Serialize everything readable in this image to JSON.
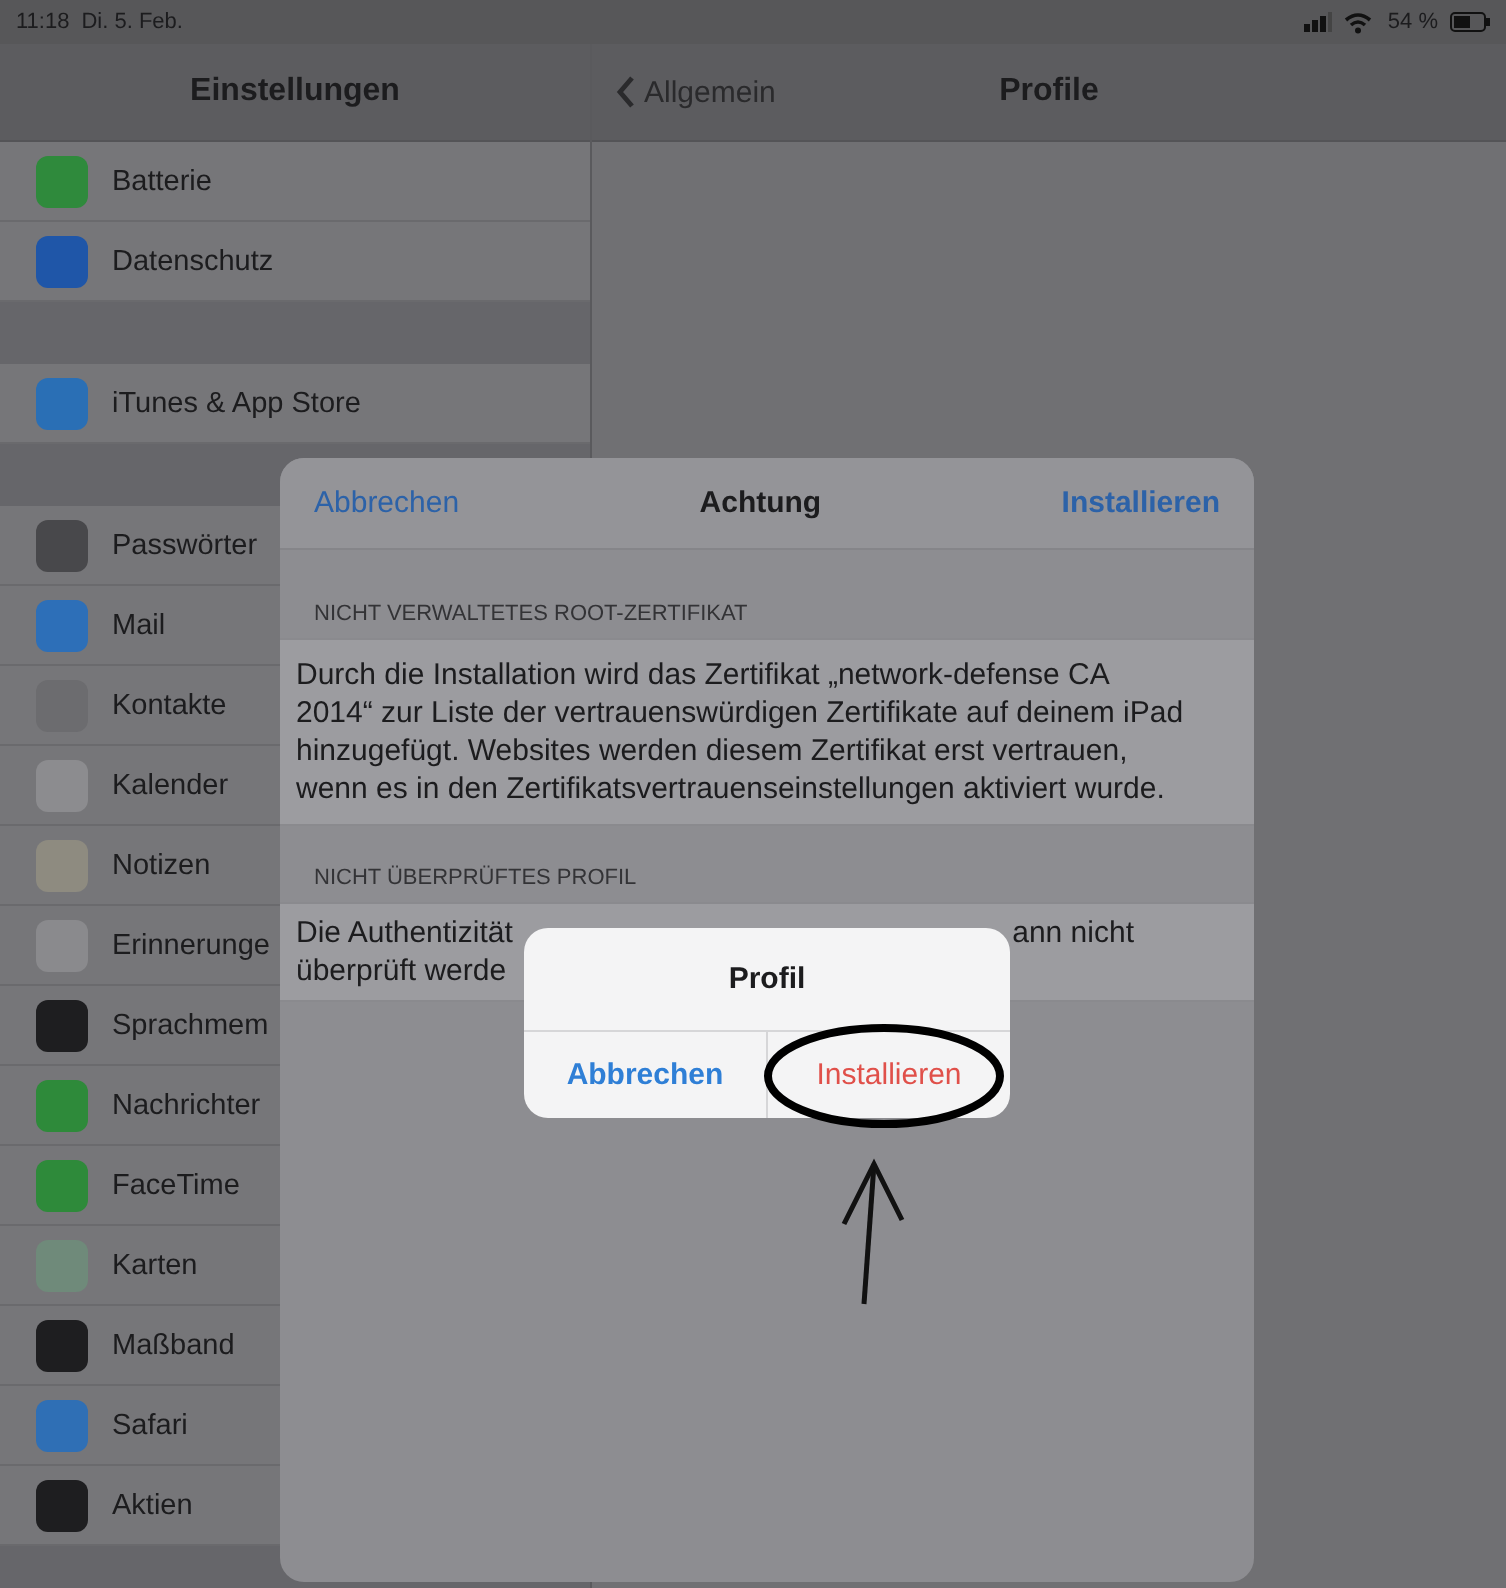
{
  "status_bar": {
    "time": "11:18",
    "date": "Di. 5. Feb.",
    "battery": "54 %"
  },
  "sidebar": {
    "title": "Einstellungen",
    "groups": [
      {
        "items": [
          {
            "label": "Batterie",
            "color": "#2f8a3c"
          },
          {
            "label": "Datenschutz",
            "color": "#1f56a8"
          }
        ]
      },
      {
        "items": [
          {
            "label": "iTunes & App Store",
            "color": "#2a6fb5"
          }
        ]
      },
      {
        "items": [
          {
            "label": "Passwörter",
            "color": "#48484b"
          },
          {
            "label": "Mail",
            "color": "#2d6fb8"
          },
          {
            "label": "Kontakte",
            "color": "#6c6c6f"
          },
          {
            "label": "Kalender",
            "color": "#8c8c8f"
          },
          {
            "label": "Notizen",
            "color": "#8e8b80"
          },
          {
            "label": "Erinnerunge",
            "color": "#8a8a8d"
          },
          {
            "label": "Sprachmem",
            "color": "#1e1e20"
          },
          {
            "label": "Nachrichter",
            "color": "#2e8a3a"
          },
          {
            "label": "FaceTime",
            "color": "#2e8a3a"
          },
          {
            "label": "Karten",
            "color": "#6f8a7a"
          },
          {
            "label": "Maßband",
            "color": "#1e1e20"
          },
          {
            "label": "Safari",
            "color": "#2f6fb5"
          },
          {
            "label": "Aktien",
            "color": "#1e1e20"
          }
        ]
      }
    ]
  },
  "detail": {
    "back": "Allgemein",
    "title": "Profile"
  },
  "sheet": {
    "cancel": "Abbrechen",
    "title": "Achtung",
    "confirm": "Installieren",
    "section_1": {
      "header": "NICHT VERWALTETES ROOT-ZERTIFIKAT",
      "lines": [
        "Durch die Installation wird das Zertifikat „network-defense CA",
        "2014“ zur Liste der vertrauenswürdigen Zertifikate auf deinem iPad",
        "hinzugefügt. Websites werden diesem Zertifikat erst vertrauen,",
        "wenn es in den Zertifikatsvertrauenseinstellungen aktiviert wurde."
      ]
    },
    "section_2": {
      "header": "NICHT ÜBERPRÜFTES PROFIL",
      "left_lines": [
        "Die Authentizität",
        "überprüft werde"
      ],
      "right_lines": [
        "ann nicht"
      ]
    }
  },
  "alert": {
    "title": "Profil",
    "buttons": [
      {
        "label": "Abbrechen",
        "kind": "cancel"
      },
      {
        "label": "Installieren",
        "kind": "destructive"
      }
    ]
  }
}
